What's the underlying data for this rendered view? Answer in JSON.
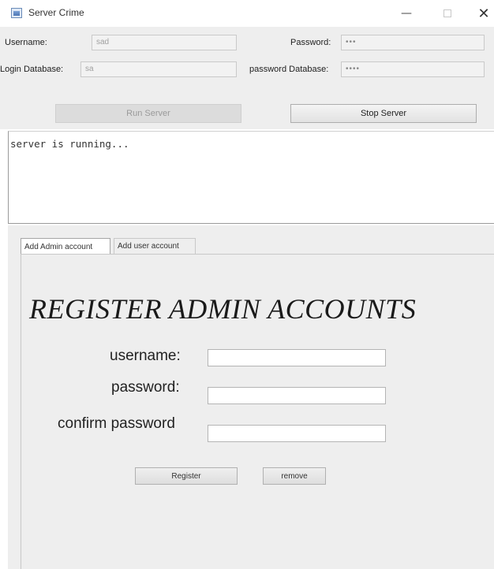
{
  "window": {
    "title": "Server Crime",
    "minimize": "—",
    "close": "✕"
  },
  "credentials": {
    "username_label": "Username:",
    "username_value": "sad",
    "password_label": "Password:",
    "password_value": "•••",
    "login_db_label": "Login Database:",
    "login_db_value": "sa",
    "password_db_label": "password Database:",
    "password_db_value": "••••"
  },
  "server_buttons": {
    "run": "Run Server",
    "stop": "Stop Server",
    "run_enabled": false
  },
  "console": {
    "text": "server is running..."
  },
  "tabs": [
    {
      "label": "Add Admin account",
      "active": true
    },
    {
      "label": "Add user account",
      "active": false
    }
  ],
  "register_form": {
    "title": "REGISTER ADMIN ACCOUNTS",
    "username_label": "username:",
    "username_value": "",
    "password_label": "password:",
    "password_value": "",
    "confirm_label": "confirm password",
    "confirm_value": "",
    "register_button": "Register",
    "remove_button": "remove"
  },
  "icons": {
    "app": "window-app-icon",
    "minimize": "minimize-icon",
    "maximize": "maximize-icon",
    "close": "close-icon"
  }
}
